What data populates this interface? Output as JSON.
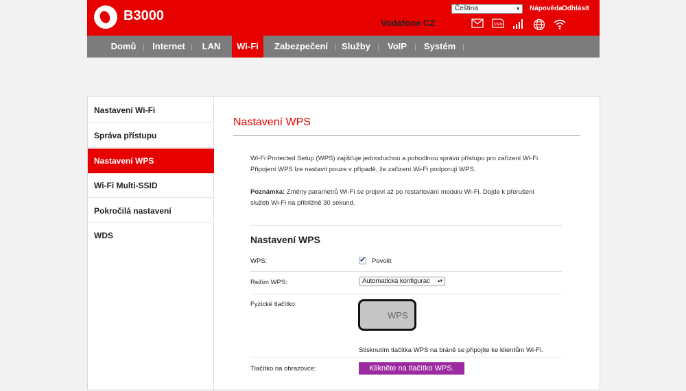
{
  "header": {
    "brand": "B3000",
    "operator": "Vodafone CZ",
    "language": "Čeština",
    "help_link": "Nápověda",
    "logout_link": "Odhlásit",
    "icons": [
      "mail-icon",
      "usim-icon",
      "signal-icon",
      "globe-icon",
      "wifi-icon"
    ]
  },
  "nav": {
    "items": [
      {
        "label": "Domů"
      },
      {
        "label": "Internet"
      },
      {
        "label": "LAN"
      },
      {
        "label": "Wi-Fi"
      },
      {
        "label": "Zabezpečení"
      },
      {
        "label": "Služby"
      },
      {
        "label": "VoIP"
      },
      {
        "label": "Systém"
      }
    ],
    "active": "Wi-Fi"
  },
  "sidebar": {
    "items": [
      {
        "label": "Nastavení Wi-Fi"
      },
      {
        "label": "Správa přístupu"
      },
      {
        "label": "Nastavení WPS"
      },
      {
        "label": "Wi-Fi Multi-SSID"
      },
      {
        "label": "Pokročilá nastavení"
      },
      {
        "label": "WDS"
      }
    ],
    "active": "Nastavení WPS"
  },
  "main": {
    "title": "Nastavení WPS",
    "intro": "Wi-Fi Protected Setup (WPS) zajišťuje jednoduchou a pohodlnou správu přístupu pro zařízení Wi-Fi. Připojení WPS lze nastavit pouze v případě, že zařízení Wi-Fi podporují WPS.",
    "note_label": "Poznámka:",
    "note_text": " Změny parametrů Wi-Fi se projeví až po restartování modulu Wi-Fi. Dojde k přerušení služeb Wi-Fi na přibližně 30 sekund.",
    "section_title": "Nastavení WPS",
    "wps_label": "WPS:",
    "wps_checkbox_label": "Povolit",
    "wps_enabled": true,
    "mode_label": "Režim WPS:",
    "mode_value": "Automatická konfigurac",
    "physical_label": "Fyzické tlačítko:",
    "physical_button_text": "WPS",
    "hint": "Stisknutím tlačítka WPS na bráně se připojíte ke klientům Wi-Fi.",
    "screen_label": "Tlačítko na obrazovce:",
    "screen_button": "Klikněte na tlačítko WPS."
  },
  "colors": {
    "brand_red": "#e60000",
    "nav_gray": "#7c7c7c",
    "wps_button": "#9c2aa0"
  }
}
